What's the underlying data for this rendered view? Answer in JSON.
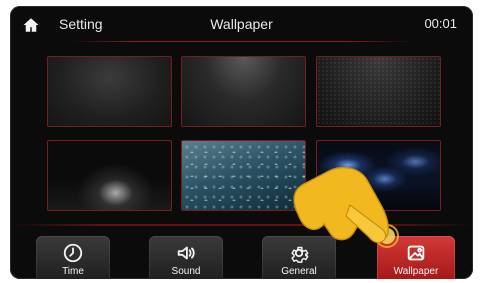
{
  "topbar": {
    "home_icon": "home-icon",
    "left_title": "Setting",
    "center_title": "Wallpaper",
    "time": "00:01"
  },
  "wallpapers": [
    {
      "name": "dark-fabric",
      "selected": false
    },
    {
      "name": "dark-spotlight",
      "selected": false
    },
    {
      "name": "dark-mesh",
      "selected": false
    },
    {
      "name": "black-floor-light",
      "selected": false
    },
    {
      "name": "water-drops",
      "selected": true
    },
    {
      "name": "blue-lights-grid",
      "selected": false
    }
  ],
  "dock": {
    "tabs": [
      {
        "key": "time",
        "label": "Time",
        "icon": "clock-icon",
        "active": false
      },
      {
        "key": "sound",
        "label": "Sound",
        "icon": "speaker-icon",
        "active": false
      },
      {
        "key": "general",
        "label": "General",
        "icon": "gear-icon",
        "active": false
      },
      {
        "key": "wallpaper",
        "label": "Wallpaper",
        "icon": "image-icon",
        "active": true
      }
    ]
  },
  "colors": {
    "accent_red": "#b3191c",
    "pointer_yellow": "#f2b820"
  }
}
